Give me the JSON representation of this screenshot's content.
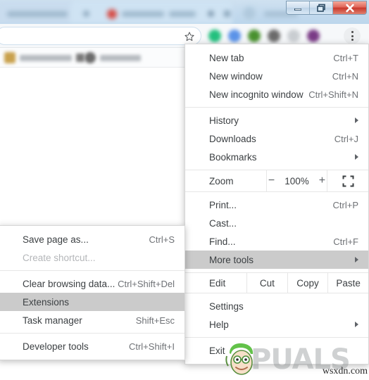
{
  "window": {
    "controls": [
      {
        "name": "minimize",
        "label": "Minimize"
      },
      {
        "name": "restore",
        "label": "Restore"
      },
      {
        "name": "close",
        "label": "Close"
      }
    ]
  },
  "toolbar": {
    "address_value": "",
    "address_placeholder": "",
    "bookmark_star": "star-icon",
    "menu_button": "three-dot-menu-icon",
    "extension_colors": [
      "#23c07e",
      "#5b93e8",
      "#49912f",
      "#6b6b6b",
      "#c9cdd1",
      "#7a3b86"
    ]
  },
  "bookmarks_bar": {
    "items": [
      {
        "label": ""
      },
      {
        "label": ""
      }
    ]
  },
  "main_menu": {
    "items": [
      {
        "label": "New tab",
        "accel": "Ctrl+T",
        "arrow": false,
        "highlight": false,
        "disabled": false
      },
      {
        "label": "New window",
        "accel": "Ctrl+N",
        "arrow": false,
        "highlight": false,
        "disabled": false
      },
      {
        "label": "New incognito window",
        "accel": "Ctrl+Shift+N",
        "arrow": false,
        "highlight": false,
        "disabled": false
      },
      {
        "label": "History",
        "accel": "",
        "arrow": true,
        "highlight": false,
        "disabled": false
      },
      {
        "label": "Downloads",
        "accel": "Ctrl+J",
        "arrow": false,
        "highlight": false,
        "disabled": false
      },
      {
        "label": "Bookmarks",
        "accel": "",
        "arrow": true,
        "highlight": false,
        "disabled": false
      },
      {
        "label": "Print...",
        "accel": "Ctrl+P",
        "arrow": false,
        "highlight": false,
        "disabled": false
      },
      {
        "label": "Cast...",
        "accel": "",
        "arrow": false,
        "highlight": false,
        "disabled": false
      },
      {
        "label": "Find...",
        "accel": "Ctrl+F",
        "arrow": false,
        "highlight": false,
        "disabled": false
      },
      {
        "label": "More tools",
        "accel": "",
        "arrow": true,
        "highlight": true,
        "disabled": false
      },
      {
        "label": "Settings",
        "accel": "",
        "arrow": false,
        "highlight": false,
        "disabled": false
      },
      {
        "label": "Help",
        "accel": "",
        "arrow": true,
        "highlight": false,
        "disabled": false
      },
      {
        "label": "Exit",
        "accel": "",
        "arrow": false,
        "highlight": false,
        "disabled": false
      }
    ],
    "zoom_row": {
      "label": "Zoom",
      "minus": "−",
      "percent": "100%",
      "plus": "+",
      "fullscreen_icon": "fullscreen-icon"
    },
    "edit_row": {
      "label": "Edit",
      "cut": "Cut",
      "copy": "Copy",
      "paste": "Paste"
    }
  },
  "sub_menu": {
    "items": [
      {
        "label": "Save page as...",
        "accel": "Ctrl+S",
        "disabled": false,
        "highlight": false
      },
      {
        "label": "Create shortcut...",
        "accel": "",
        "disabled": true,
        "highlight": false
      },
      {
        "label": "Clear browsing data...",
        "accel": "Ctrl+Shift+Del",
        "disabled": false,
        "highlight": false
      },
      {
        "label": "Extensions",
        "accel": "",
        "disabled": false,
        "highlight": true
      },
      {
        "label": "Task manager",
        "accel": "Shift+Esc",
        "disabled": false,
        "highlight": false
      },
      {
        "label": "Developer tools",
        "accel": "Ctrl+Shift+I",
        "disabled": false,
        "highlight": false
      }
    ]
  },
  "watermark": {
    "brand": "PUALS",
    "url": "wsxdn.com"
  },
  "colors": {
    "highlight": "#cbcbcb",
    "menu_text": "#3c4043",
    "accel_text": "#6f7276",
    "disabled_text": "#b4b6b9",
    "tabstrip": "#c3daee",
    "close_button": "#c8392c"
  }
}
